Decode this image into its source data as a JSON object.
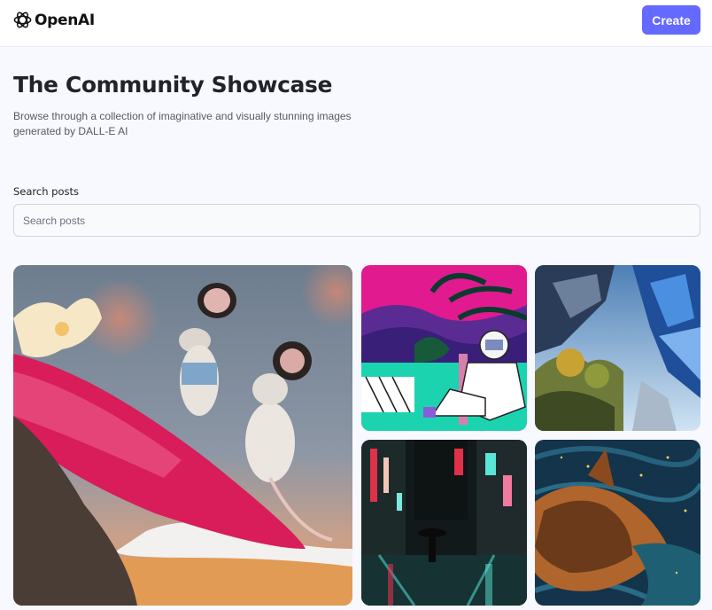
{
  "header": {
    "logo_text": "OpenAI",
    "logo_icon": "openai-knot-icon",
    "create_label": "Create"
  },
  "main": {
    "title": "The Community Showcase",
    "subtitle": "Browse through a collection of imaginative and visually stunning images generated by DALL-E AI"
  },
  "search": {
    "label": "Search posts",
    "placeholder": "Search posts",
    "value": ""
  },
  "colors": {
    "accent": "#6469ff",
    "background": "#f8f9fe",
    "title": "#222328"
  }
}
